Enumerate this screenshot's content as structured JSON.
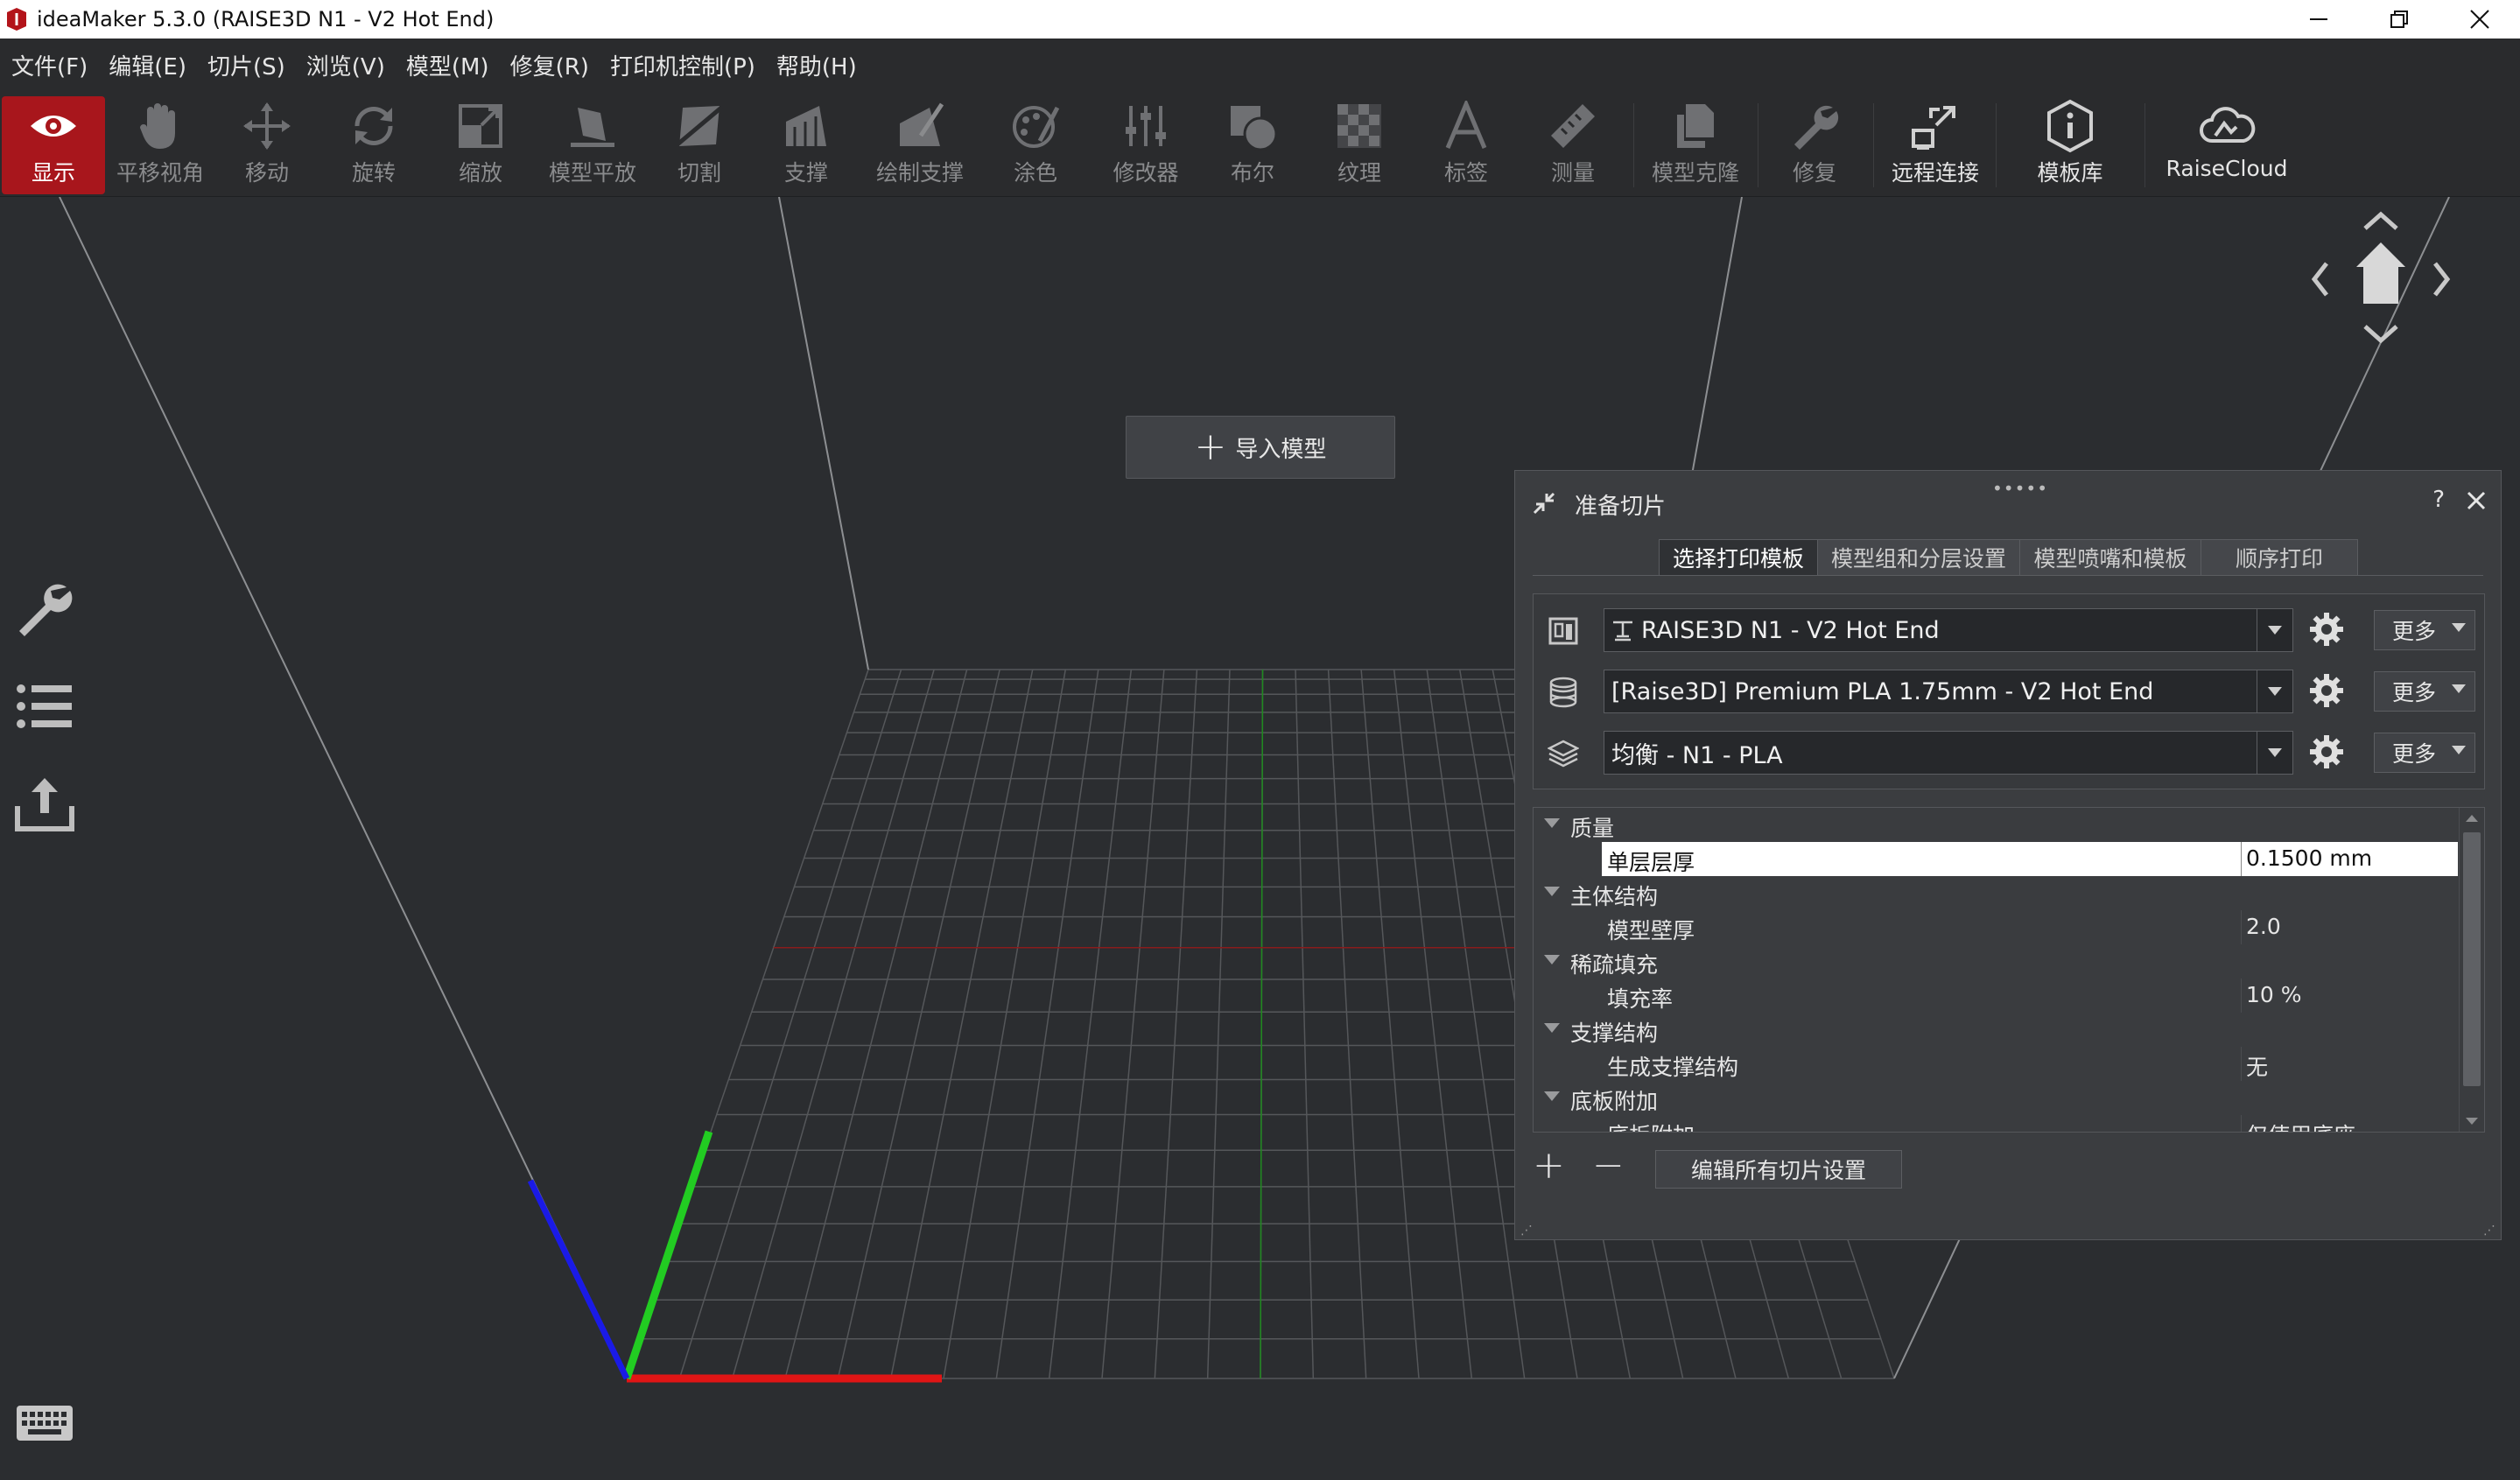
{
  "window": {
    "title": "ideaMaker 5.3.0 (RAISE3D N1 - V2 Hot End)"
  },
  "menu": [
    "文件(F)",
    "编辑(E)",
    "切片(S)",
    "浏览(V)",
    "模型(M)",
    "修复(R)",
    "打印机控制(P)",
    "帮助(H)"
  ],
  "toolbar": {
    "items": [
      {
        "label": "显示",
        "icon": "eye-icon"
      },
      {
        "label": "平移视角",
        "icon": "hand-icon"
      },
      {
        "label": "移动",
        "icon": "move-icon"
      },
      {
        "label": "旋转",
        "icon": "rotate-icon"
      },
      {
        "label": "缩放",
        "icon": "scale-icon"
      },
      {
        "label": "模型平放",
        "icon": "lay-flat-icon"
      },
      {
        "label": "切割",
        "icon": "cut-icon"
      },
      {
        "label": "支撑",
        "icon": "support-icon"
      },
      {
        "label": "绘制支撑",
        "icon": "paint-support-icon"
      },
      {
        "label": "涂色",
        "icon": "paint-icon"
      },
      {
        "label": "修改器",
        "icon": "modifier-icon"
      },
      {
        "label": "布尔",
        "icon": "boolean-icon"
      },
      {
        "label": "纹理",
        "icon": "texture-icon"
      },
      {
        "label": "标签",
        "icon": "text-label-icon"
      },
      {
        "label": "测量",
        "icon": "ruler-icon"
      },
      {
        "label": "模型克隆",
        "icon": "clone-icon"
      },
      {
        "label": "修复",
        "icon": "repair-icon"
      },
      {
        "label": "远程连接",
        "icon": "remote-connect-icon"
      },
      {
        "label": "模板库",
        "icon": "template-library-icon"
      },
      {
        "label": "RaiseCloud",
        "icon": "cloud-icon"
      }
    ],
    "active_color": "#a8161c"
  },
  "viewport": {
    "import_label": "导入模型"
  },
  "panel": {
    "title": "准备切片",
    "help": "?",
    "tabs": [
      "选择打印模板",
      "模型组和分层设置",
      "模型喷嘴和模板",
      "顺序打印"
    ],
    "selectors": [
      {
        "value": "RAISE3D N1 - V2 Hot End",
        "more": "更多"
      },
      {
        "value": "[Raise3D] Premium PLA 1.75mm - V2 Hot End",
        "more": "更多"
      },
      {
        "value": "均衡 - N1 - PLA",
        "more": "更多"
      }
    ],
    "tree": [
      {
        "type": "category",
        "label": "质量"
      },
      {
        "type": "setting",
        "label": "单层层厚",
        "value": "0.1500 mm",
        "selected": true
      },
      {
        "type": "category",
        "label": "主体结构"
      },
      {
        "type": "setting",
        "label": "模型壁厚",
        "value": "2.0"
      },
      {
        "type": "category",
        "label": "稀疏填充"
      },
      {
        "type": "setting",
        "label": "填充率",
        "value": "10 %"
      },
      {
        "type": "category",
        "label": "支撑结构"
      },
      {
        "type": "setting",
        "label": "生成支撑结构",
        "value": "无"
      },
      {
        "type": "category",
        "label": "底板附加"
      },
      {
        "type": "setting",
        "label": "底板附加",
        "value": "仅使用底座"
      }
    ],
    "edit_all_label": "编辑所有切片设置"
  }
}
